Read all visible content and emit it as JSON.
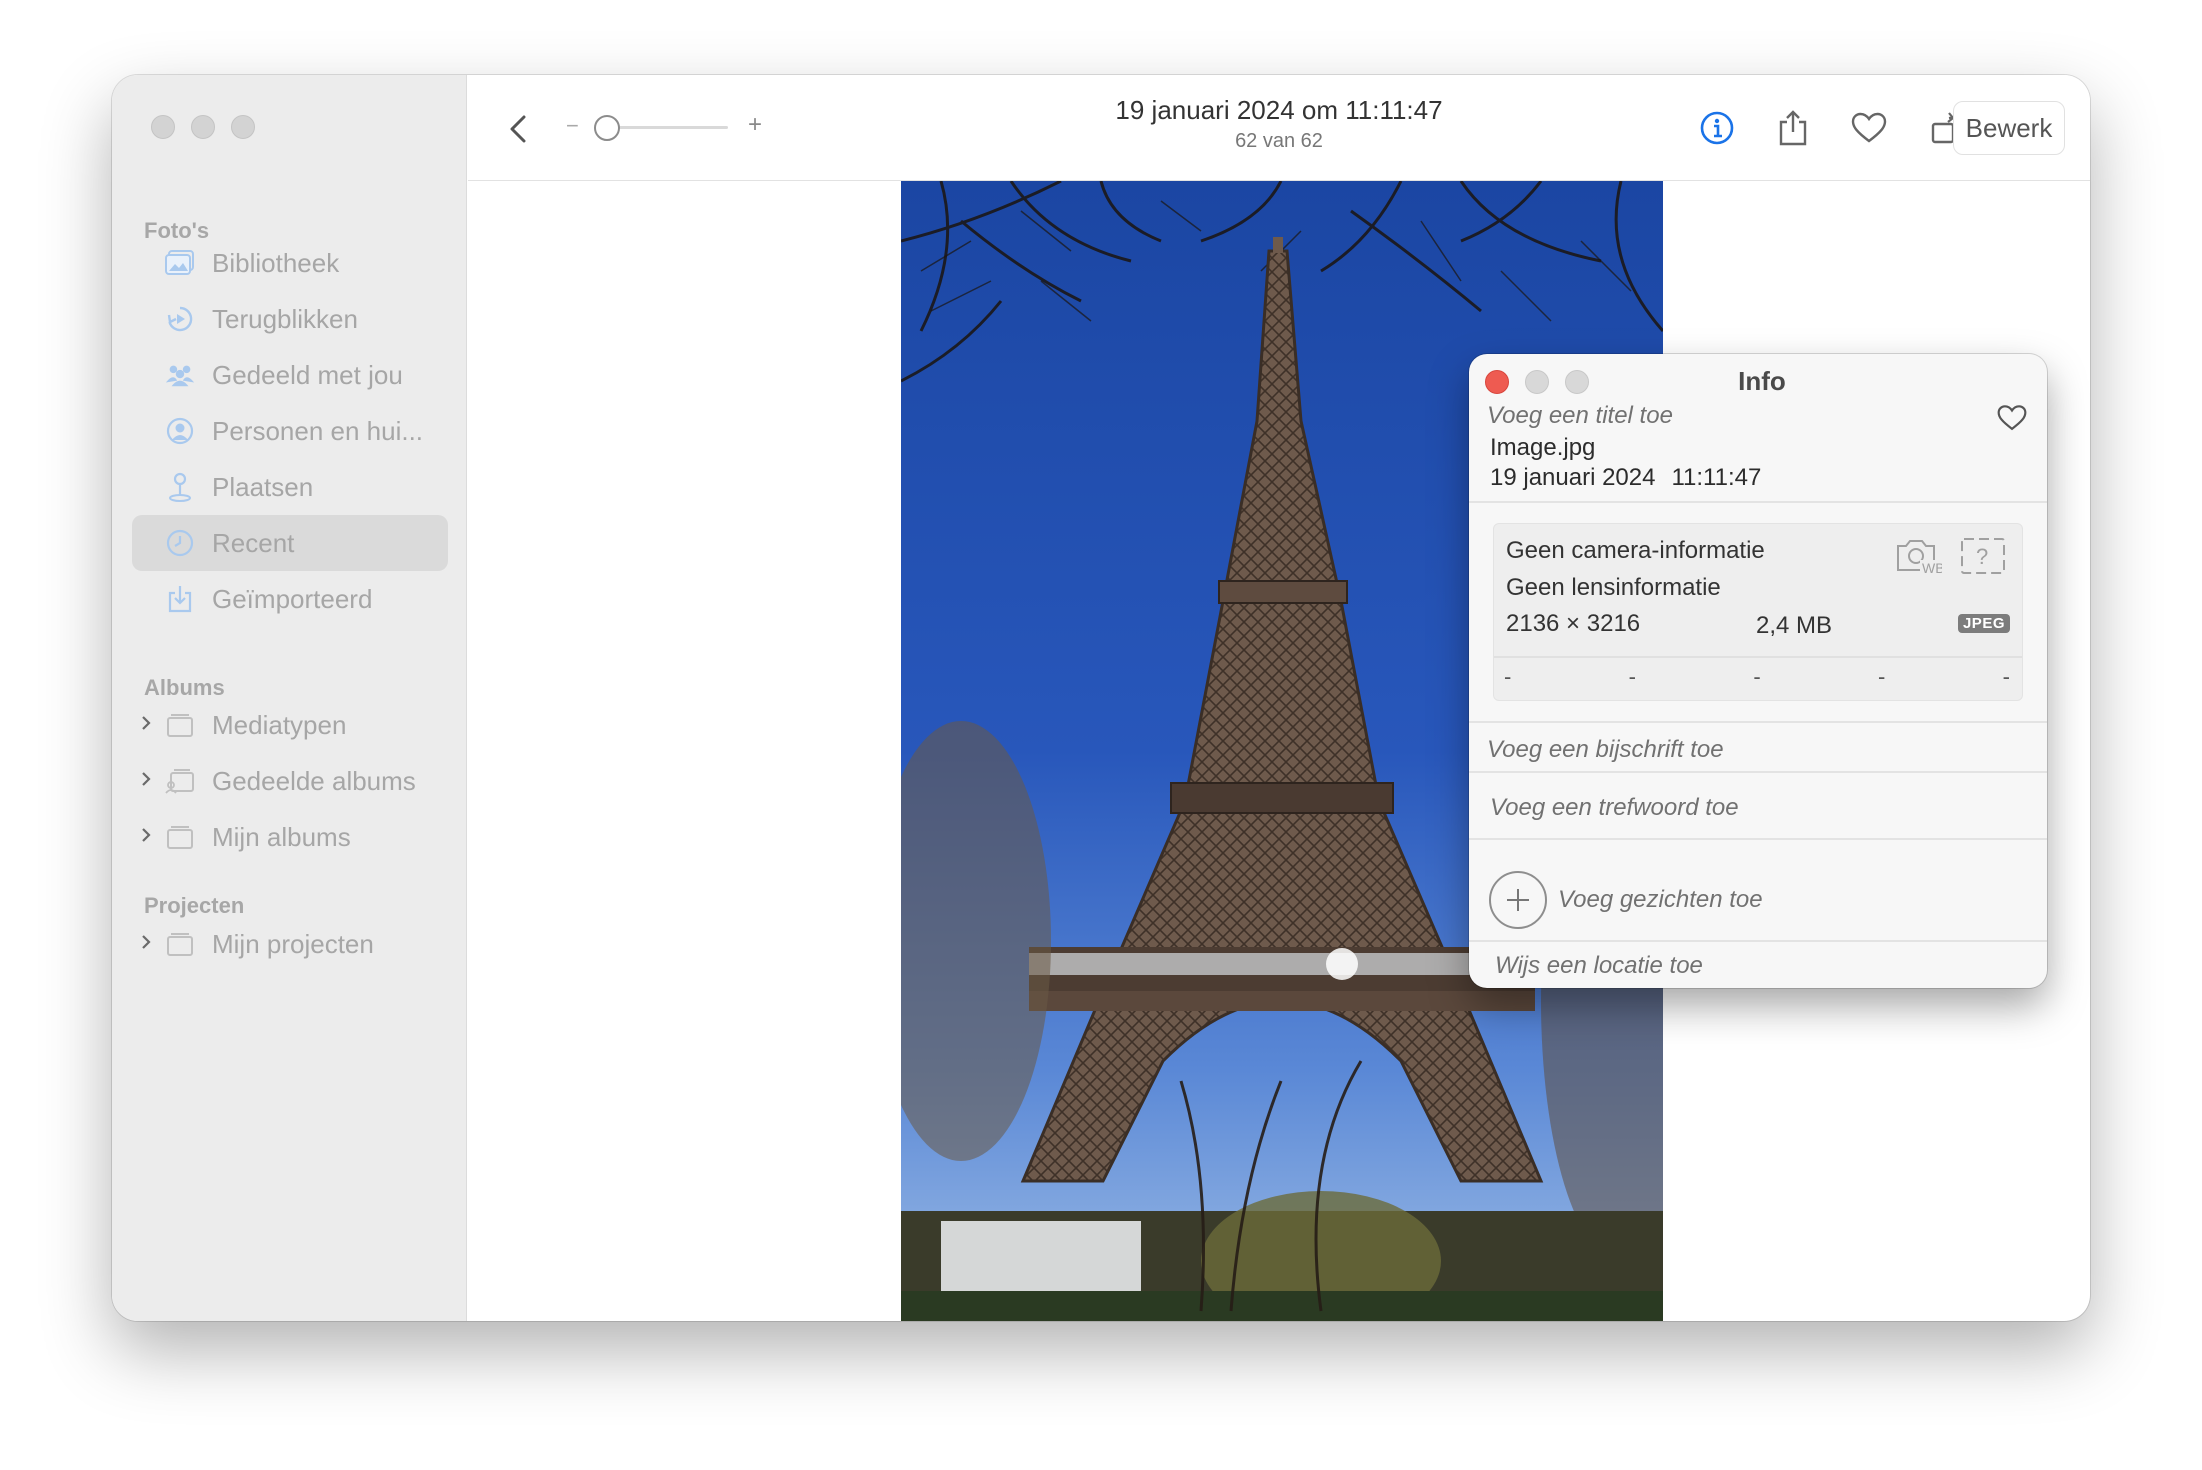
{
  "sidebar": {
    "sections": {
      "photos": "Foto's",
      "albums": "Albums",
      "projects": "Projecten"
    },
    "photo_items": [
      {
        "label": "Bibliotheek",
        "icon": "library-icon"
      },
      {
        "label": "Terugblikken",
        "icon": "memories-icon"
      },
      {
        "label": "Gedeeld met jou",
        "icon": "shared-with-you-icon"
      },
      {
        "label": "Personen en hui...",
        "icon": "people-icon"
      },
      {
        "label": "Plaatsen",
        "icon": "places-icon"
      },
      {
        "label": "Recent",
        "icon": "recent-icon",
        "selected": true
      },
      {
        "label": "Geïmporteerd",
        "icon": "imported-icon"
      }
    ],
    "album_items": [
      {
        "label": "Mediatypen",
        "icon": "folder-icon"
      },
      {
        "label": "Gedeelde albums",
        "icon": "shared-album-icon"
      },
      {
        "label": "Mijn albums",
        "icon": "folder-icon"
      }
    ],
    "project_items": [
      {
        "label": "Mijn projecten",
        "icon": "folder-icon"
      }
    ]
  },
  "toolbar": {
    "zoom_minus": "−",
    "zoom_plus": "+",
    "zoom_level": 0.0,
    "title": "19 januari 2024 om 11:11:47",
    "subtitle": "62 van 62",
    "edit_label": "Bewerk",
    "icons": [
      "info-icon",
      "share-icon",
      "heart-icon",
      "rotate-icon",
      "enhance-icon"
    ],
    "accent": "#1a73e8"
  },
  "info_panel": {
    "title": "Info",
    "title_placeholder": "Voeg een titel toe",
    "filename": "Image.jpg",
    "date": "19 januari 2024",
    "time": "11:11:47",
    "camera": "Geen camera-informatie",
    "lens": "Geen lensinformatie",
    "dimensions": "2136 × 3216",
    "filesize": "2,4 MB",
    "format": "JPEG",
    "exif_dashes": [
      "-",
      "-",
      "-",
      "-",
      "-"
    ],
    "caption_placeholder": "Voeg een bijschrift toe",
    "keyword_placeholder": "Voeg een trefwoord toe",
    "faces_placeholder": "Voeg gezichten toe",
    "location_placeholder": "Wijs een locatie toe"
  }
}
